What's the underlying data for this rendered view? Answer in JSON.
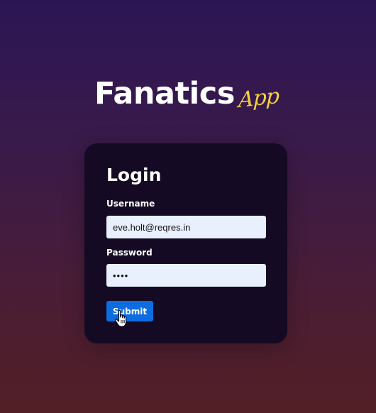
{
  "brand": {
    "name": "Fanatics",
    "suffix": "App"
  },
  "login": {
    "title": "Login",
    "username_label": "Username",
    "username_value": "eve.holt@reqres.in",
    "password_label": "Password",
    "password_value": "••••",
    "submit_label": "Submit"
  },
  "colors": {
    "card_bg": "#150a24",
    "accent_yellow": "#f4d03f",
    "button_blue": "#0d6de0",
    "input_bg": "#e8f0fe"
  },
  "icons": {
    "cursor": "hand-pointer-icon"
  }
}
